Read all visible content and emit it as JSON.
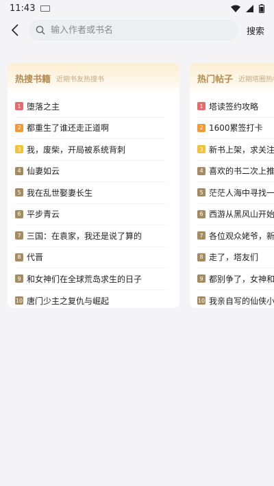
{
  "status": {
    "time": "11:43"
  },
  "search": {
    "placeholder": "输入作者或书名",
    "button_label": "搜索"
  },
  "hot_books": {
    "title": "热搜书籍",
    "subtitle": "近期书友热搜书",
    "items": [
      {
        "rank": "1",
        "title": "堕落之主"
      },
      {
        "rank": "2",
        "title": "都重生了谁还走正道啊"
      },
      {
        "rank": "3",
        "title": "我，废柴，开局被系统背刺"
      },
      {
        "rank": "4",
        "title": "仙妻如云"
      },
      {
        "rank": "5",
        "title": "我在乱世娶妻长生"
      },
      {
        "rank": "6",
        "title": "平步青云"
      },
      {
        "rank": "7",
        "title": "三国：在袁家，我还是说了算的"
      },
      {
        "rank": "8",
        "title": "代晋"
      },
      {
        "rank": "9",
        "title": "和女神们在全球荒岛求生的日子"
      },
      {
        "rank": "10",
        "title": "唐门少主之复仇与崛起"
      }
    ]
  },
  "hot_posts": {
    "title": "热门帖子",
    "subtitle": "近期塔圈热帖",
    "items": [
      {
        "rank": "1",
        "title": "塔读签约攻略"
      },
      {
        "rank": "2",
        "title": "1600累签打卡"
      },
      {
        "rank": "3",
        "title": "新书上架，求关注"
      },
      {
        "rank": "4",
        "title": "喜欢的书二次上推"
      },
      {
        "rank": "5",
        "title": "茫茫人海中寻找一"
      },
      {
        "rank": "6",
        "title": "西游从黑风山开始"
      },
      {
        "rank": "7",
        "title": "各位观众姥爷，新"
      },
      {
        "rank": "8",
        "title": "走了，塔友们"
      },
      {
        "rank": "9",
        "title": "都别争了，女神和"
      },
      {
        "rank": "10",
        "title": "我亲自写的仙侠小"
      }
    ]
  }
}
